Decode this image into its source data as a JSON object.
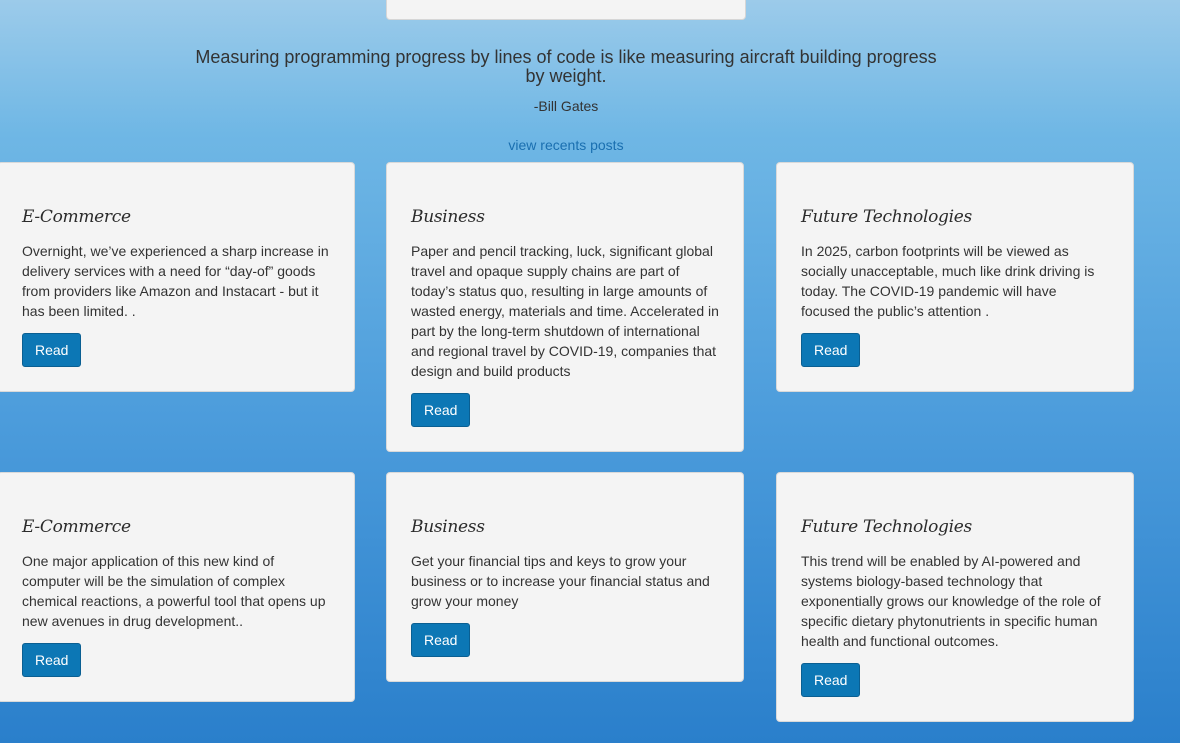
{
  "quote": {
    "text": "Measuring programming progress by lines of code is like measuring aircraft building progress by weight.",
    "author": "-Bill Gates"
  },
  "recent_link": "view recents posts",
  "cards": [
    {
      "title": "E-Commerce",
      "text": "Overnight, we’ve experienced a sharp increase in delivery services with a need for “day-of” goods from providers like Amazon and Instacart - but it has been limited. .",
      "button": "Read"
    },
    {
      "title": "Business",
      "text": "Paper and pencil tracking, luck, significant global travel and opaque supply chains are part of today’s status quo, resulting in large amounts of wasted energy, materials and time. Accelerated in part by the long-term shutdown of international and regional travel by COVID-19, companies that design and build products",
      "button": "Read"
    },
    {
      "title": "Future Technologies",
      "text": "In 2025, carbon footprints will be viewed as socially unacceptable, much like drink driving is today. The COVID-19 pandemic will have focused the public’s attention .",
      "button": "Read"
    },
    {
      "title": "E-Commerce",
      "text": "One major application of this new kind of computer will be the simulation of complex chemical reactions, a powerful tool that opens up new avenues in drug development..",
      "button": "Read"
    },
    {
      "title": "Business",
      "text": "Get your financial tips and keys to grow your business or to increase your financial status and grow your money",
      "button": "Read"
    },
    {
      "title": "Future Technologies",
      "text": "This trend will be enabled by AI-powered and systems biology-based technology that exponentially grows our knowledge of the role of specific dietary phytonutrients in specific human health and functional outcomes.",
      "button": "Read"
    }
  ]
}
